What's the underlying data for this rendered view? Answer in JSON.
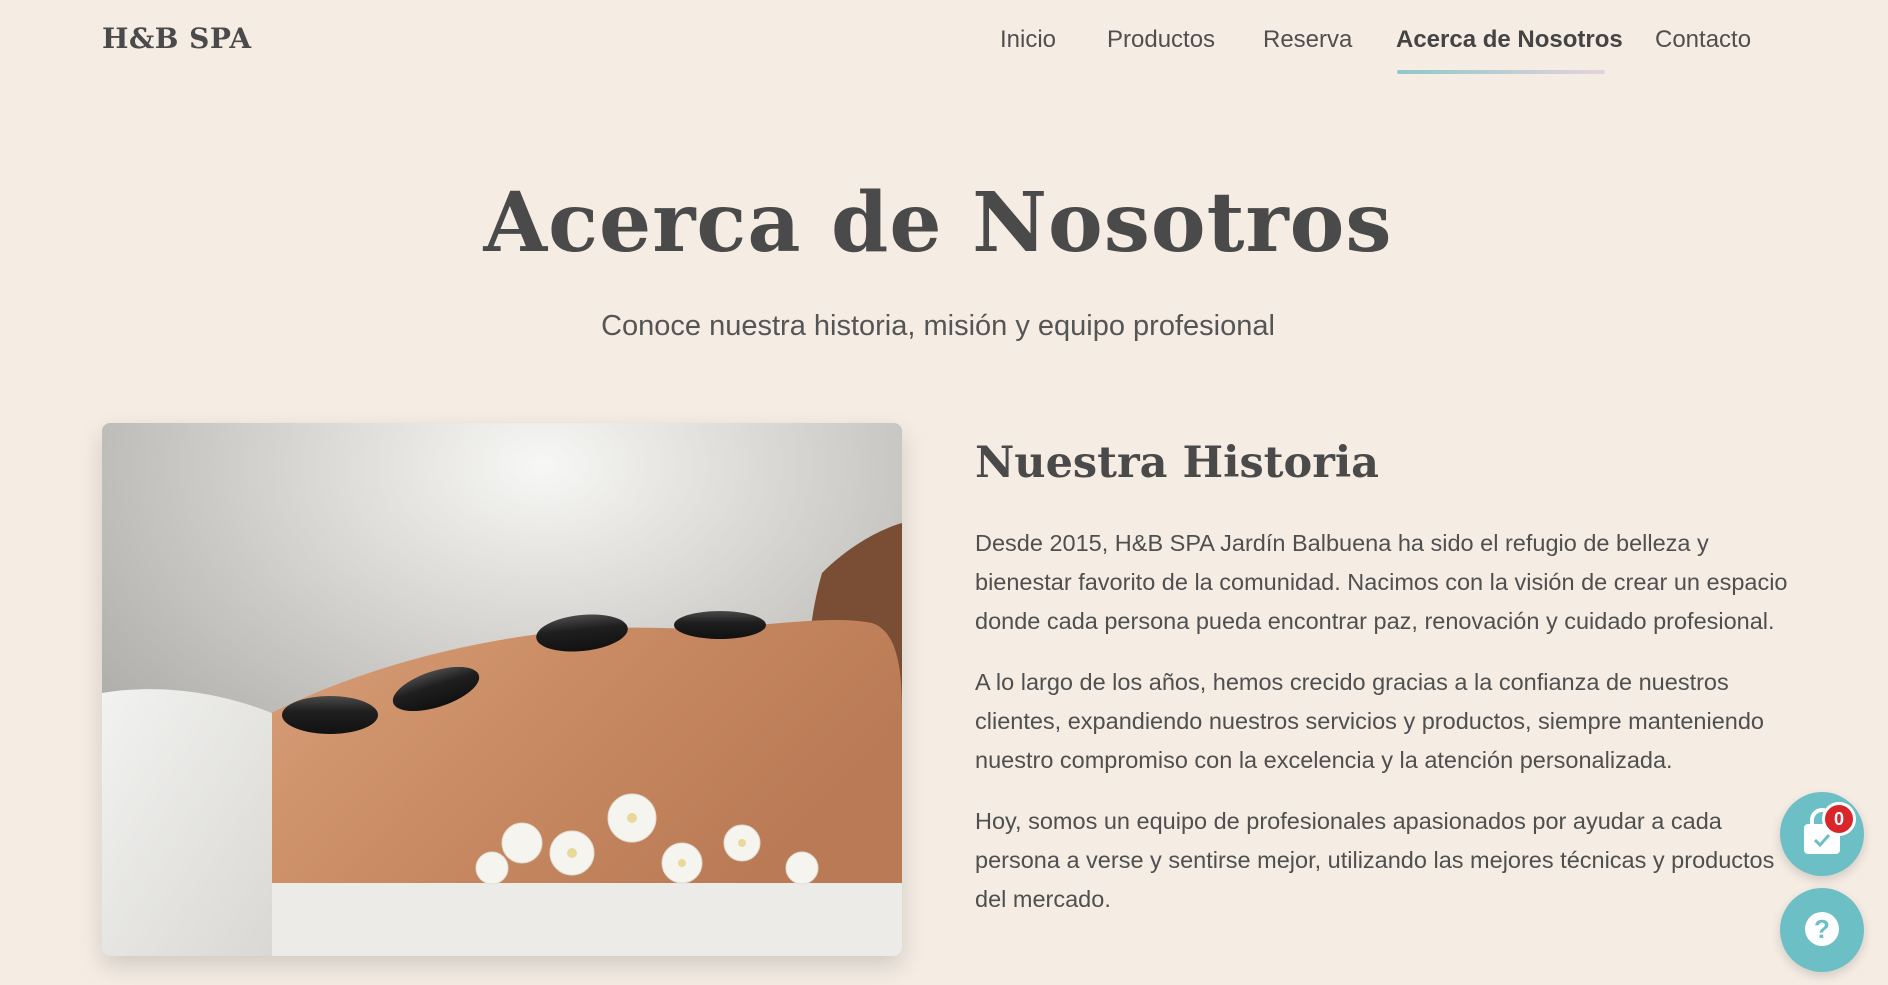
{
  "header": {
    "brand": "H&B SPA",
    "nav": [
      {
        "label": "Inicio"
      },
      {
        "label": "Productos"
      },
      {
        "label": "Reserva"
      },
      {
        "label": "Acerca de Nosotros",
        "active": true
      },
      {
        "label": "Contacto"
      }
    ]
  },
  "hero": {
    "title": "Acerca de Nosotros",
    "subtitle": "Conoce nuestra historia, misión y equipo profesional"
  },
  "history": {
    "title": "Nuestra Historia",
    "paragraphs": [
      "Desde 2015, H&B SPA Jardín Balbuena ha sido el refugio de belleza y bienestar favorito de la comunidad. Nacimos con la visión de crear un espacio donde cada persona pueda encontrar paz, renovación y cuidado profesional.",
      "A lo largo de los años, hemos crecido gracias a la confianza de nuestros clientes, expandiendo nuestros servicios y productos, siempre manteniendo nuestro compromiso con la excelencia y la atención personalizada.",
      "Hoy, somos un equipo de profesionales apasionados por ayudar a cada persona a verse y sentirse mejor, utilizando las mejores técnicas y productos del mercado."
    ]
  },
  "floating": {
    "cart_count": "0",
    "help_symbol": "?"
  },
  "icons": {
    "cart": "shopping-bag-icon",
    "help": "question-icon"
  },
  "colors": {
    "background": "#f5ede4",
    "accent": "#6cbfc4",
    "badge": "#d8262b",
    "text": "#4a4a4a"
  }
}
